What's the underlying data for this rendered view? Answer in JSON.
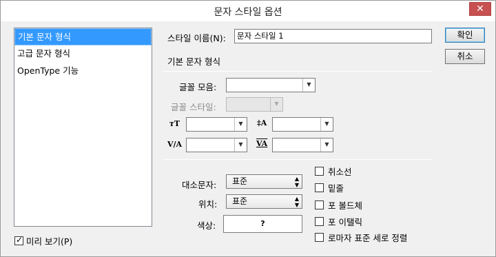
{
  "window": {
    "title": "문자 스타일 옵션",
    "close_glyph": "✕"
  },
  "sidebar": {
    "items": [
      {
        "label": "기본 문자 형식"
      },
      {
        "label": "고급 문자 형식"
      },
      {
        "label": "OpenType 기능"
      }
    ]
  },
  "preview": {
    "label": "미리 보기(P)",
    "checked": true
  },
  "style_name": {
    "label": "스타일 이름(N):",
    "value": "문자 스타일 1"
  },
  "buttons": {
    "ok": "확인",
    "cancel": "취소"
  },
  "section": {
    "title": "기본 문자 형식"
  },
  "font": {
    "family_label": "글꼴 모음:",
    "family_value": "",
    "style_label": "글꼴 스타일:",
    "style_value": ""
  },
  "metrics": {
    "size_icon": "тT",
    "leading_icon": "‡A",
    "kerning_icon": "V/A",
    "tracking_icon": "VA",
    "size_value": "",
    "leading_value": "",
    "kerning_value": "",
    "tracking_value": ""
  },
  "case": {
    "label": "대소문자:",
    "value": "표준"
  },
  "position": {
    "label": "위치:",
    "value": "표준"
  },
  "color": {
    "label": "색상:",
    "value": "?"
  },
  "options": [
    {
      "label": "취소선",
      "checked": false
    },
    {
      "label": "밑줄",
      "checked": false
    },
    {
      "label": "포 볼드체",
      "checked": false
    },
    {
      "label": "포 이탤릭",
      "checked": false
    },
    {
      "label": "로마자 표준 세로 정렬",
      "checked": false
    }
  ],
  "colors": {
    "selection": "#3399ff",
    "close": "#c75050"
  }
}
